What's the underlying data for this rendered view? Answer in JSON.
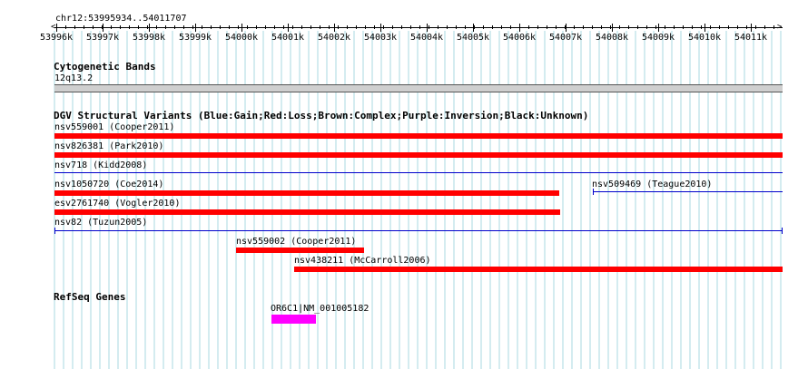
{
  "ruler": {
    "location": "chr12:53995934..54011707",
    "ticks": [
      "53996k",
      "53997k",
      "53998k",
      "53999k",
      "54000k",
      "54001k",
      "54002k",
      "54003k",
      "54004k",
      "54005k",
      "54006k",
      "54007k",
      "54008k",
      "54009k",
      "54010k",
      "54011k"
    ]
  },
  "cytogenetic": {
    "title": "Cytogenetic Bands",
    "band": "12q13.2"
  },
  "dgv": {
    "title": "DGV Structural Variants (Blue:Gain;Red:Loss;Brown:Complex;Purple:Inversion;Black:Unknown)",
    "features": [
      {
        "label": "nsv559001 (Cooper2011)",
        "type": "loss"
      },
      {
        "label": "nsv826381 (Park2010)",
        "type": "loss"
      },
      {
        "label": "nsv718 (Kidd2008)",
        "type": "gain"
      },
      {
        "label": "nsv1050720 (Coe2014)",
        "type": "loss"
      },
      {
        "label": "nsv509469 (Teague2010)",
        "type": "gain"
      },
      {
        "label": "esv2761740 (Vogler2010)",
        "type": "loss"
      },
      {
        "label": "nsv82 (Tuzun2005)",
        "type": "gain"
      },
      {
        "label": "nsv559002 (Cooper2011)",
        "type": "loss"
      },
      {
        "label": "nsv438211 (McCarroll2006)",
        "type": "loss"
      }
    ]
  },
  "refseq": {
    "title": "RefSeq Genes",
    "genes": [
      {
        "label": "OR6C1|NM_001005182"
      }
    ]
  },
  "colors": {
    "loss": "#ff0000",
    "gain": "#0000cc",
    "gene": "#ff00ff",
    "grid": "#a8d8e0"
  }
}
